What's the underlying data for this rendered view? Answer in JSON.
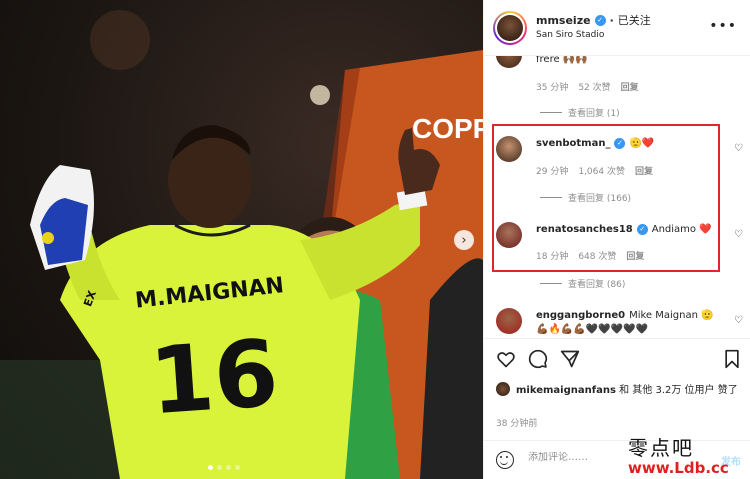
{
  "photo": {
    "jersey_name": "M.MAIGNAN",
    "jersey_number": "16",
    "board_text": "COPPA",
    "sponsor_text": "EX"
  },
  "header": {
    "username": "mmseize",
    "follow_status": "已关注",
    "location": "San Siro Stadio",
    "more_icon": "more-horizontal-icon"
  },
  "comments": [
    {
      "text": "frere 🙌🏾🙌🏾",
      "time": "35 分钟",
      "likes": "52 次赞",
      "reply": "回复",
      "view_replies": "查看回复 (1)"
    },
    {
      "username": "svenbotman_",
      "text": "🫡❤️",
      "time": "29 分钟",
      "likes": "1,064 次赞",
      "reply": "回复",
      "view_replies": "查看回复 (166)"
    },
    {
      "username": "renatosanches18",
      "text": "Andiamo ❤️",
      "time": "18 分钟",
      "likes": "648 次赞",
      "reply": "回复",
      "view_replies": "查看回复 (86)"
    },
    {
      "username": "enggangborne0",
      "text": "Mike Maignan 🫡",
      "text2": "💪🏾🔥💪🏾💪🏾🖤🖤🖤🖤🖤"
    }
  ],
  "likes_line": {
    "liker": "mikemaignanfans",
    "text": "和 其他 3.2万 位用户 赞了"
  },
  "time_ago": "38 分钟前",
  "add_comment": {
    "placeholder": "添加评论……",
    "post_label": "发布"
  },
  "watermark": {
    "cn": "零点吧",
    "url": "www.Ldb.cc"
  },
  "colors": {
    "highlight_border": "#e0262b",
    "verified": "#3897f0",
    "jersey": "#d8f33a"
  }
}
